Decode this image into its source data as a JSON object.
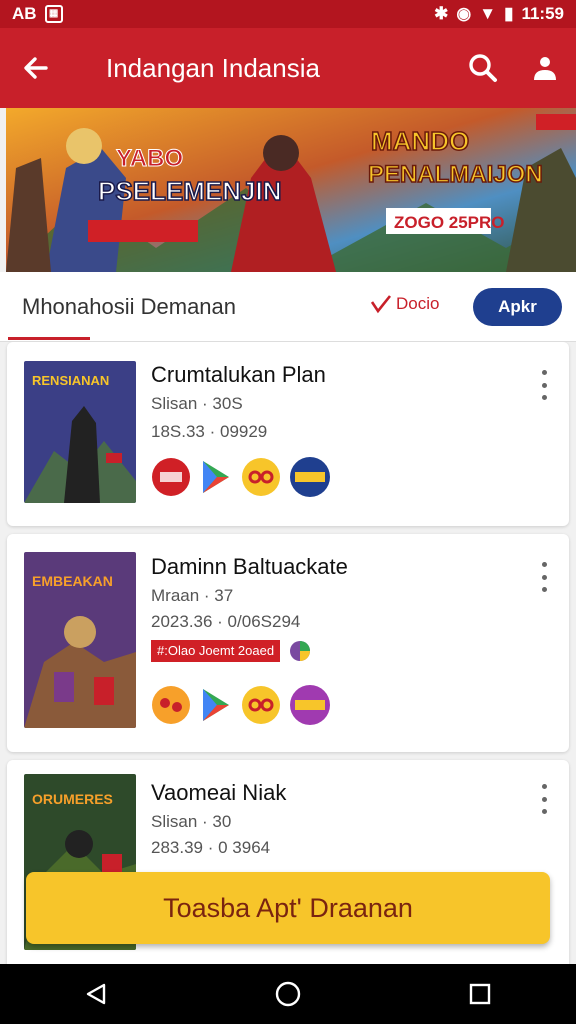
{
  "status_bar": {
    "left_text": "AB",
    "time": "11:59"
  },
  "app_bar": {
    "title": "Indangan Indansia"
  },
  "banner": {
    "left_line1": "YABO",
    "left_line2": "PSELEMENJIN",
    "right_line1": "MANDO",
    "right_line2": "PENALMAIJON",
    "right_chip": "ZOGO 25PRO"
  },
  "tabs": {
    "main_label": "Mhonahosii Demanan",
    "check_label": "Docio",
    "button_label": "Apkr"
  },
  "games": [
    {
      "title": "Crumtalukan Plan",
      "line1": "Slisan · 30S",
      "line2": "18S.33 · 09929",
      "cover_text": "RENSIANAN",
      "cover_color": "#3b3f86"
    },
    {
      "title": "Daminn Baltuackate",
      "line1": "Mraan · 37",
      "line2": "2023.36 · 0/06S294",
      "badge": "#:Olao Joemt 2oaed",
      "cover_text": "EMBEAKAN",
      "cover_color": "#5a3a7a"
    },
    {
      "title": "Vaomeai Niak",
      "line1": "Slisan · 30",
      "line2": "283.39 · 0 3964",
      "cover_text": "ORUMERES",
      "cover_color": "#2e4a2a"
    }
  ],
  "cta_label": "Toasba Apt' Draanan",
  "colors": {
    "primary": "#c8202a",
    "accent": "#1f3f8f",
    "cta": "#f7c52a"
  }
}
